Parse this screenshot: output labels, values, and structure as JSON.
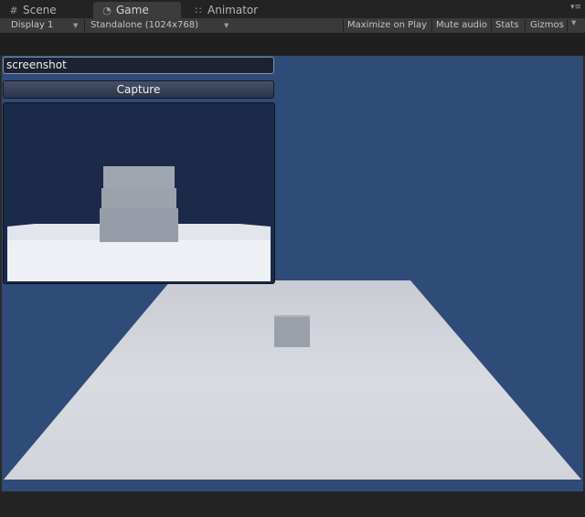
{
  "tabs": {
    "scene": {
      "label": "Scene",
      "icon": "grid-icon"
    },
    "game": {
      "label": "Game",
      "icon": "pacman-icon"
    },
    "animator": {
      "label": "Animator",
      "icon": "animator-icon"
    }
  },
  "toolbar": {
    "display": "Display 1",
    "resolution": "Standalone (1024x768)",
    "maximize_on_play": "Maximize on Play",
    "mute_audio": "Mute audio",
    "stats": "Stats",
    "gizmos": "Gizmos"
  },
  "gui": {
    "filename_value": "screenshot",
    "capture_label": "Capture"
  },
  "colors": {
    "sky": "#2f4b78",
    "ground": "#d6d9df",
    "cube": "#9aa0aa",
    "preview_bg": "#1b2a48"
  }
}
